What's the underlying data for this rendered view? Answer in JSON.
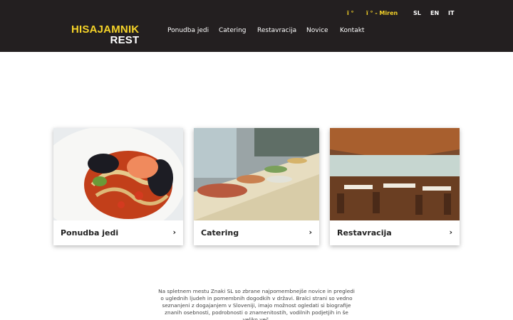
{
  "brand": {
    "line1": "HISAJAMNIK",
    "line2": "REST"
  },
  "topbar": {
    "phone": "ï °",
    "location": "ï ° - Miren"
  },
  "languages": [
    "SL",
    "EN",
    "IT"
  ],
  "nav": {
    "items": [
      "Ponudba jedi",
      "Catering",
      "Restavracija",
      "Novice",
      "Kontakt"
    ]
  },
  "cards": [
    {
      "title": "Ponudba jedi",
      "chevron": "›"
    },
    {
      "title": "Catering",
      "chevron": "›"
    },
    {
      "title": "Restavracija",
      "chevron": "›"
    }
  ],
  "intro": {
    "text": "Na spletnem mestu Znaki SL so zbrane najpomembnejše novice in pregledi o uglednih ljudeh in pomembnih dogodkih v državi. Bralci strani so vedno seznanjeni z dogajanjem v Sloveniji, imajo možnost ogledati si biografije znanih osebnosti, podrobnosti o znamenitostih, vodilnih podjetjih in še veliko več."
  },
  "colors": {
    "header_bg": "#231f20",
    "accent": "#f5d328"
  }
}
